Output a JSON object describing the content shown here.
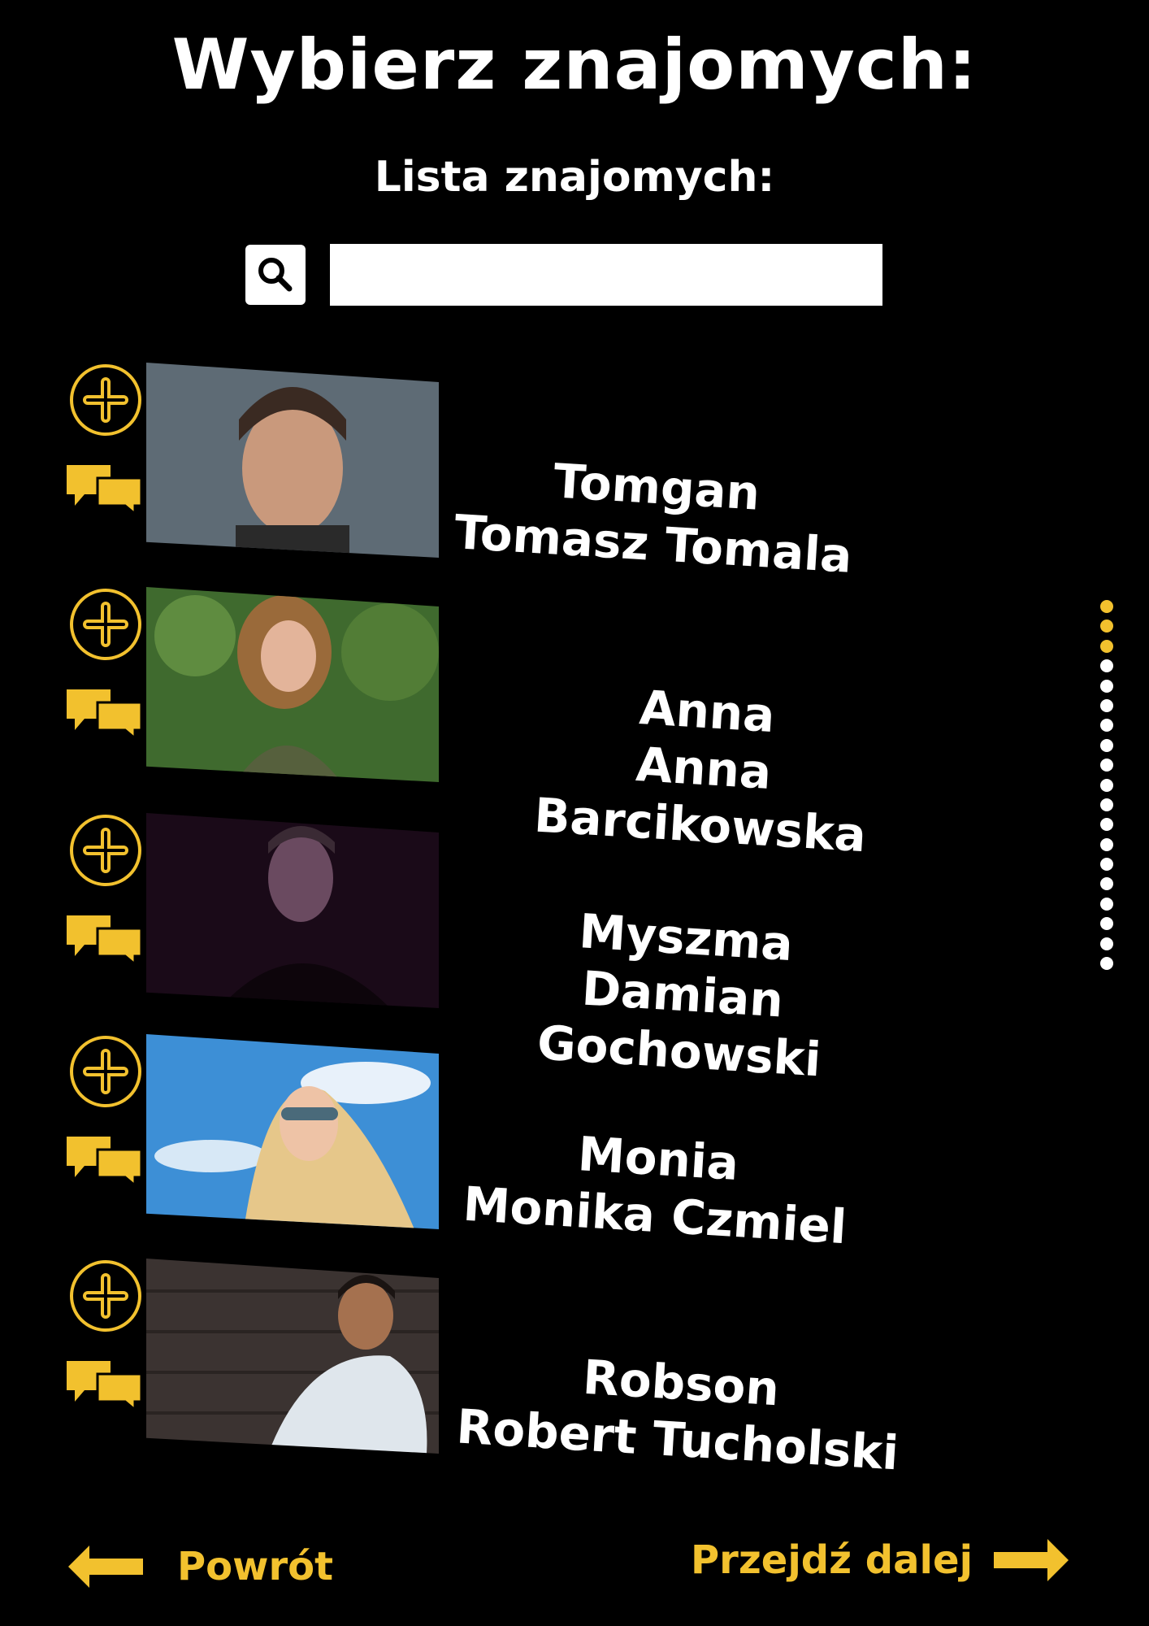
{
  "header": {
    "title": "Wybierz znajomych:",
    "subtitle": "Lista znajomych:"
  },
  "search": {
    "placeholder": "",
    "value": ""
  },
  "friends": [
    {
      "nickname": "Tomgan",
      "full_name": "Tomasz Tomala"
    },
    {
      "nickname": "Anna",
      "full_name": "Anna Barcikowska"
    },
    {
      "nickname": "Myszma",
      "full_name": "Damian Gochowski"
    },
    {
      "nickname": "Monia",
      "full_name": "Monika Czmiel"
    },
    {
      "nickname": "Robson",
      "full_name": "Robert Tucholski"
    }
  ],
  "scroll": {
    "total_dots": 19,
    "active_dots": 3
  },
  "navigation": {
    "back_label": "Powrót",
    "next_label": "Przejdź dalej"
  },
  "colors": {
    "accent": "#f2c12e",
    "background": "#000000",
    "text": "#ffffff"
  },
  "icons": {
    "search": "search-icon",
    "add": "plus-circle-icon",
    "chat": "chat-bubbles-icon",
    "back": "arrow-left-icon",
    "next": "arrow-right-icon"
  }
}
